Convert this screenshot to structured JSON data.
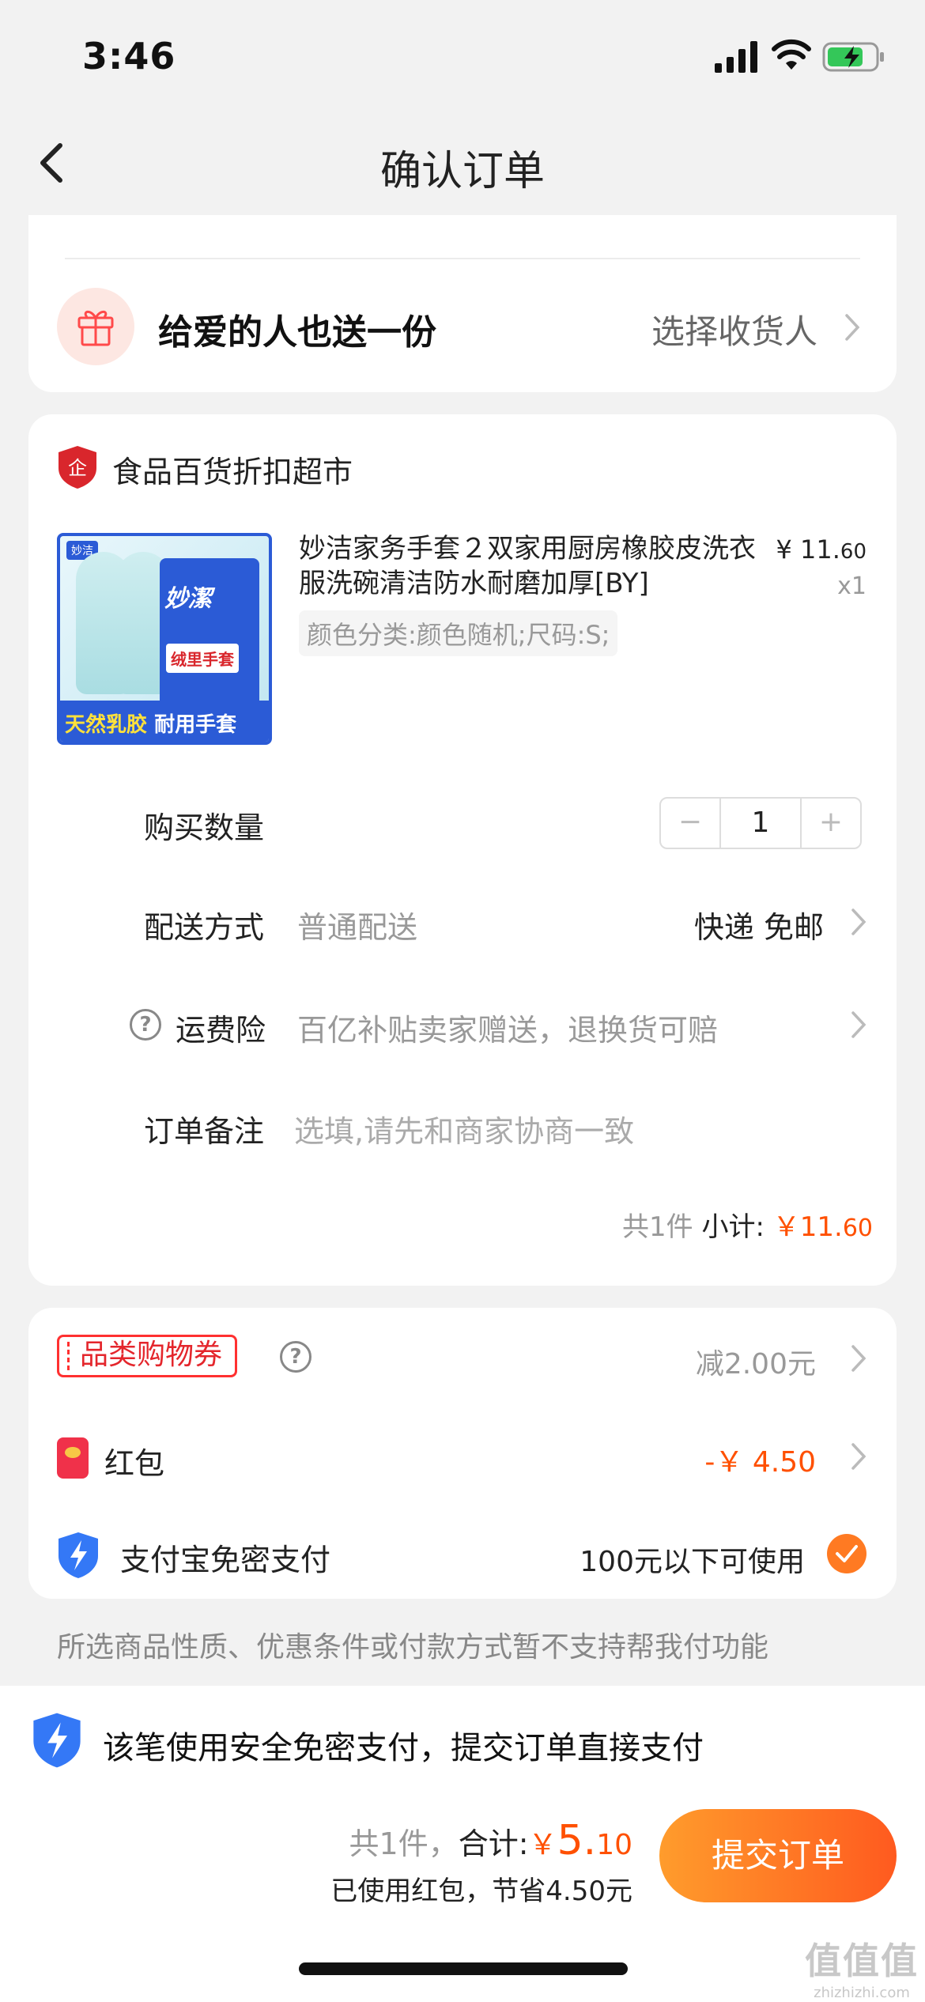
{
  "status_bar": {
    "time": "3:46"
  },
  "nav": {
    "title": "确认订单"
  },
  "gift": {
    "title": "给爱的人也送一份",
    "action": "选择收货人"
  },
  "shop": {
    "name": "食品百货折扣超市",
    "product": {
      "title": "妙洁家务手套２双家用厨房橡胶皮洗衣服洗碗清洁防水耐磨加厚[BY]",
      "price_main": "¥ 11.",
      "price_cents": "60",
      "quantity_text": "x1",
      "variant": "颜色分类:颜色随机;尺码:S;",
      "image_brand": "妙洁",
      "image_logo": "妙潔",
      "image_tag": "绒里手套",
      "image_band_highlight": "天然乳胶",
      "image_band_text": "耐用手套"
    },
    "qty_label": "购买数量",
    "qty_minus": "−",
    "qty_value": "1",
    "qty_plus": "+",
    "delivery_label": "配送方式",
    "delivery_value": "普通配送",
    "delivery_right": "快递 免邮",
    "insurance_label": "运费险",
    "insurance_value": "百亿补贴卖家赠送，退换货可赔",
    "note_label": "订单备注",
    "note_placeholder": "选填,请先和商家协商一致",
    "subtotal_count": "共1件",
    "subtotal_label": "小计:",
    "subtotal_main": "￥11.",
    "subtotal_cents": "60"
  },
  "discounts": {
    "coupon_label": "品类购物券",
    "coupon_value": "减2.00元",
    "redpacket_label": "红包",
    "redpacket_value": "-￥ 4.50",
    "alipay_label": "支付宝免密支付",
    "alipay_value": "100元以下可使用"
  },
  "notice": "所选商品性质、优惠条件或付款方式暂不支持帮我付功能",
  "bottom": {
    "secure_text": "该笔使用安全免密支付，提交订单直接支付",
    "count": "共1件，",
    "total_label": "合计:",
    "total_currency": "￥",
    "total_main": "5.",
    "total_cents": "10",
    "saved": "已使用红包，节省4.50元",
    "submit": "提交订单"
  },
  "watermark": {
    "logo": "值值值",
    "site": "zhizhizhi.com"
  },
  "colors": {
    "accent": "#ff5000",
    "button_start": "#ff9c2c",
    "button_end": "#ff5a1f",
    "shield_blue": "#3478f6"
  }
}
